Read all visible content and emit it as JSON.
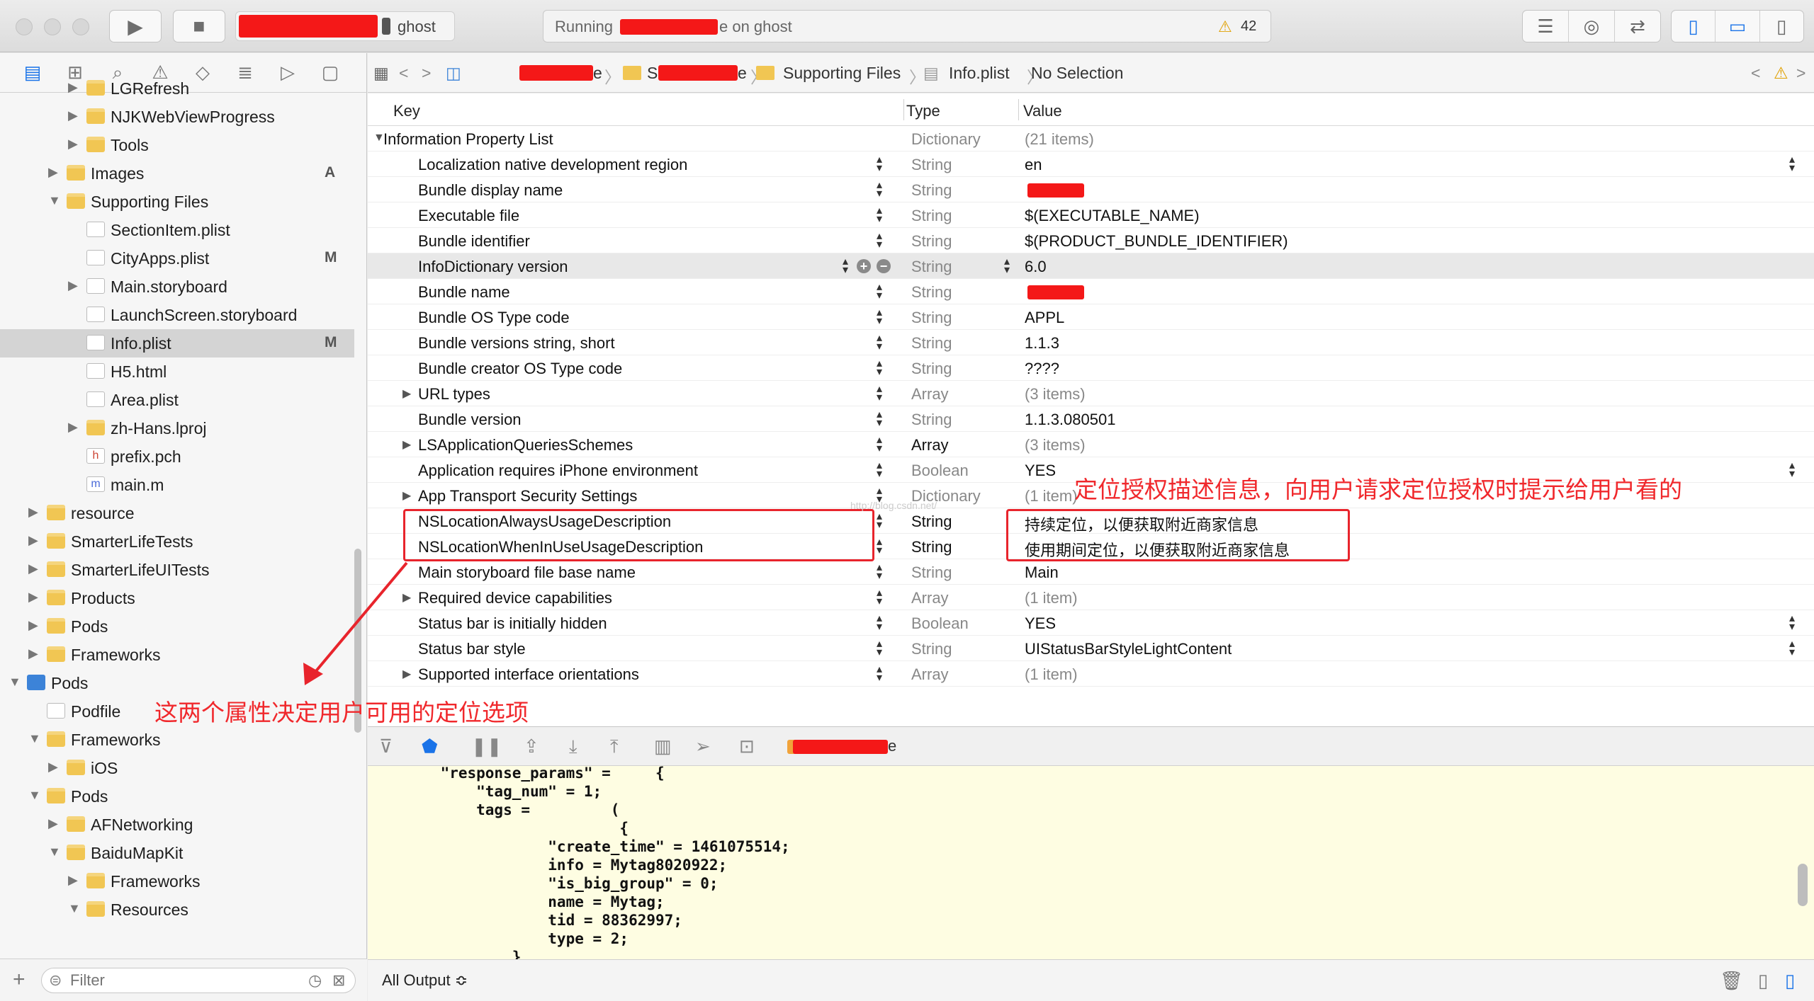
{
  "toolbar": {
    "scheme_device": "ghost",
    "activity_prefix": "Running",
    "activity_suffix": "e on ghost",
    "warning_count": "42"
  },
  "navigator": {
    "items": [
      {
        "label": "LGRefresh",
        "type": "folder",
        "depth": 3,
        "disclosure": "closed",
        "status": ""
      },
      {
        "label": "NJKWebViewProgress",
        "type": "folder",
        "depth": 3,
        "disclosure": "closed",
        "status": ""
      },
      {
        "label": "Tools",
        "type": "folder",
        "depth": 3,
        "disclosure": "closed",
        "status": ""
      },
      {
        "label": "Images",
        "type": "folder",
        "depth": 2,
        "disclosure": "closed",
        "status": "A"
      },
      {
        "label": "Supporting Files",
        "type": "folder",
        "depth": 2,
        "disclosure": "open",
        "status": ""
      },
      {
        "label": "SectionItem.plist",
        "type": "file",
        "depth": 3,
        "disclosure": "",
        "status": ""
      },
      {
        "label": "CityApps.plist",
        "type": "file",
        "depth": 3,
        "disclosure": "",
        "status": "M"
      },
      {
        "label": "Main.storyboard",
        "type": "file",
        "depth": 3,
        "disclosure": "closed",
        "status": ""
      },
      {
        "label": "LaunchScreen.storyboard",
        "type": "file",
        "depth": 3,
        "disclosure": "",
        "status": ""
      },
      {
        "label": "Info.plist",
        "type": "file",
        "depth": 3,
        "disclosure": "",
        "status": "M",
        "selected": true
      },
      {
        "label": "H5.html",
        "type": "file",
        "depth": 3,
        "disclosure": "",
        "status": ""
      },
      {
        "label": "Area.plist",
        "type": "file",
        "depth": 3,
        "disclosure": "",
        "status": ""
      },
      {
        "label": "zh-Hans.lproj",
        "type": "folder",
        "depth": 3,
        "disclosure": "closed",
        "status": ""
      },
      {
        "label": "prefix.pch",
        "type": "h",
        "depth": 3,
        "disclosure": "",
        "status": ""
      },
      {
        "label": "main.m",
        "type": "m",
        "depth": 3,
        "disclosure": "",
        "status": ""
      },
      {
        "label": "resource",
        "type": "folder",
        "depth": 1,
        "disclosure": "closed",
        "status": ""
      },
      {
        "label": "SmarterLifeTests",
        "type": "folder",
        "depth": 1,
        "disclosure": "closed",
        "status": ""
      },
      {
        "label": "SmarterLifeUITests",
        "type": "folder",
        "depth": 1,
        "disclosure": "closed",
        "status": ""
      },
      {
        "label": "Products",
        "type": "folder",
        "depth": 1,
        "disclosure": "closed",
        "status": ""
      },
      {
        "label": "Pods",
        "type": "folder",
        "depth": 1,
        "disclosure": "closed",
        "status": ""
      },
      {
        "label": "Frameworks",
        "type": "folder",
        "depth": 1,
        "disclosure": "closed",
        "status": ""
      },
      {
        "label": "Pods",
        "type": "project",
        "depth": 0,
        "disclosure": "open",
        "status": ""
      },
      {
        "label": "Podfile",
        "type": "file",
        "depth": 1,
        "disclosure": "",
        "status": ""
      },
      {
        "label": "Frameworks",
        "type": "folder",
        "depth": 1,
        "disclosure": "open",
        "status": ""
      },
      {
        "label": "iOS",
        "type": "folder",
        "depth": 2,
        "disclosure": "closed",
        "status": ""
      },
      {
        "label": "Pods",
        "type": "folder",
        "depth": 1,
        "disclosure": "open",
        "status": ""
      },
      {
        "label": "AFNetworking",
        "type": "folder",
        "depth": 2,
        "disclosure": "closed",
        "status": ""
      },
      {
        "label": "BaiduMapKit",
        "type": "folder",
        "depth": 2,
        "disclosure": "open",
        "status": ""
      },
      {
        "label": "Frameworks",
        "type": "folder",
        "depth": 3,
        "disclosure": "closed",
        "status": ""
      },
      {
        "label": "Resources",
        "type": "folder",
        "depth": 3,
        "disclosure": "open",
        "status": ""
      }
    ],
    "filter_placeholder": "Filter"
  },
  "jumpbar": {
    "crumb_redacted_suffix_1": "e",
    "crumb_folder_2_prefix": "S",
    "crumb_redacted_suffix_2": "e",
    "crumb_supporting": "Supporting Files",
    "crumb_file": "Info.plist",
    "crumb_selection": "No Selection"
  },
  "plist": {
    "headers": {
      "key": "Key",
      "type": "Type",
      "value": "Value"
    },
    "rows": [
      {
        "key": "Information Property List",
        "type": "Dictionary",
        "value": "(21 items)",
        "depth": 0,
        "disclosure": "open",
        "value_gray": true
      },
      {
        "key": "Localization native development region",
        "type": "String",
        "value": "en",
        "depth": 1,
        "right_stepper": true
      },
      {
        "key": "Bundle display name",
        "type": "String",
        "value": "",
        "depth": 1,
        "redacted": true
      },
      {
        "key": "Executable file",
        "type": "String",
        "value": "$(EXECUTABLE_NAME)",
        "depth": 1
      },
      {
        "key": "Bundle identifier",
        "type": "String",
        "value": "$(PRODUCT_BUNDLE_IDENTIFIER)",
        "depth": 1
      },
      {
        "key": "InfoDictionary version",
        "type": "String",
        "value": "6.0",
        "depth": 1,
        "selected": true
      },
      {
        "key": "Bundle name",
        "type": "String",
        "value": "",
        "depth": 1,
        "redacted": true
      },
      {
        "key": "Bundle OS Type code",
        "type": "String",
        "value": "APPL",
        "depth": 1
      },
      {
        "key": "Bundle versions string, short",
        "type": "String",
        "value": "1.1.3",
        "depth": 1
      },
      {
        "key": "Bundle creator OS Type code",
        "type": "String",
        "value": "????",
        "depth": 1
      },
      {
        "key": "URL types",
        "type": "Array",
        "value": "(3 items)",
        "depth": 1,
        "disclosure": "closed",
        "value_gray": true
      },
      {
        "key": "Bundle version",
        "type": "String",
        "value": "1.1.3.080501",
        "depth": 1
      },
      {
        "key": "LSApplicationQueriesSchemes",
        "type": "Array",
        "value": "(3 items)",
        "depth": 1,
        "disclosure": "closed",
        "value_gray": true,
        "type_dark": true
      },
      {
        "key": "Application requires iPhone environment",
        "type": "Boolean",
        "value": "YES",
        "depth": 1,
        "right_stepper": true
      },
      {
        "key": "App Transport Security Settings",
        "type": "Dictionary",
        "value": "(1 item)",
        "depth": 1,
        "disclosure": "closed",
        "value_gray": true
      },
      {
        "key": "NSLocationAlwaysUsageDescription",
        "type": "String",
        "value": "持续定位，以便获取附近商家信息",
        "depth": 1,
        "type_dark": true
      },
      {
        "key": "NSLocationWhenInUseUsageDescription",
        "type": "String",
        "value": "使用期间定位，以便获取附近商家信息",
        "depth": 1,
        "type_dark": true
      },
      {
        "key": "Main storyboard file base name",
        "type": "String",
        "value": "Main",
        "depth": 1
      },
      {
        "key": "Required device capabilities",
        "type": "Array",
        "value": "(1 item)",
        "depth": 1,
        "disclosure": "closed",
        "value_gray": true
      },
      {
        "key": "Status bar is initially hidden",
        "type": "Boolean",
        "value": "YES",
        "depth": 1,
        "right_stepper": true
      },
      {
        "key": "Status bar style",
        "type": "String",
        "value": "UIStatusBarStyleLightContent",
        "depth": 1,
        "right_stepper": true
      },
      {
        "key": "Supported interface orientations",
        "type": "Array",
        "value": "(1 item)",
        "depth": 1,
        "disclosure": "closed",
        "value_gray": true
      }
    ]
  },
  "annotations": {
    "right_note": "定位授权描述信息，向用户请求定位授权时提示给用户看的",
    "left_note": "这两个属性决定用户可用的定位选项",
    "watermark": "http://blog.csdn.net/",
    "accent_color": "#e8242c"
  },
  "debug": {
    "target_suffix": "e",
    "console_lines": [
      "    \"response_params\" =     {",
      "        \"tag_num\" = 1;",
      "        tags =         (",
      "                        {",
      "                \"create_time\" = 1461075514;",
      "                info = Mytag8020922;",
      "                \"is_big_group\" = 0;",
      "                name = Mytag;",
      "                tid = 88362997;",
      "                type = 2;",
      "            },"
    ],
    "output_selector": "All Output ≎"
  }
}
